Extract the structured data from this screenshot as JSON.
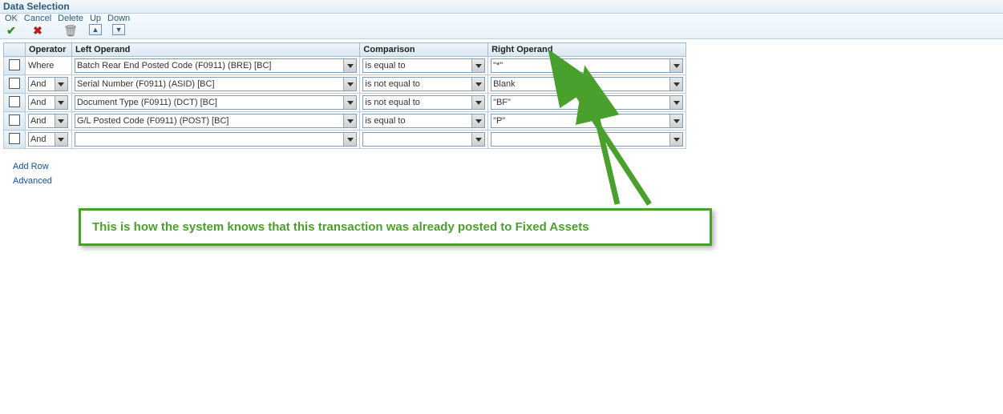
{
  "title": "Data Selection",
  "toolbar": {
    "ok": "OK",
    "cancel": "Cancel",
    "delete": "Delete",
    "up": "Up",
    "down": "Down"
  },
  "headers": {
    "operator": "Operator",
    "left": "Left Operand",
    "comparison": "Comparison",
    "right": "Right Operand"
  },
  "rows": [
    {
      "operator": "Where",
      "operator_editable": false,
      "left": "Batch Rear End Posted Code (F0911) (BRE) [BC]",
      "comparison": "is equal to",
      "right": "\"*\""
    },
    {
      "operator": "And",
      "operator_editable": true,
      "left": "Serial Number (F0911) (ASID) [BC]",
      "comparison": "is not equal to",
      "right": "Blank"
    },
    {
      "operator": "And",
      "operator_editable": true,
      "left": "Document Type (F0911) (DCT) [BC]",
      "comparison": "is not equal to",
      "right": "\"BF\""
    },
    {
      "operator": "And",
      "operator_editable": true,
      "left": "G/L Posted Code (F0911) (POST) [BC]",
      "comparison": "is equal to",
      "right": "\"P\""
    },
    {
      "operator": "And",
      "operator_editable": true,
      "left": "",
      "comparison": "",
      "right": ""
    }
  ],
  "links": {
    "add_row": "Add Row",
    "advanced": "Advanced"
  },
  "annotation": {
    "text": "This is how the system knows that this transaction was already posted to Fixed Assets"
  }
}
